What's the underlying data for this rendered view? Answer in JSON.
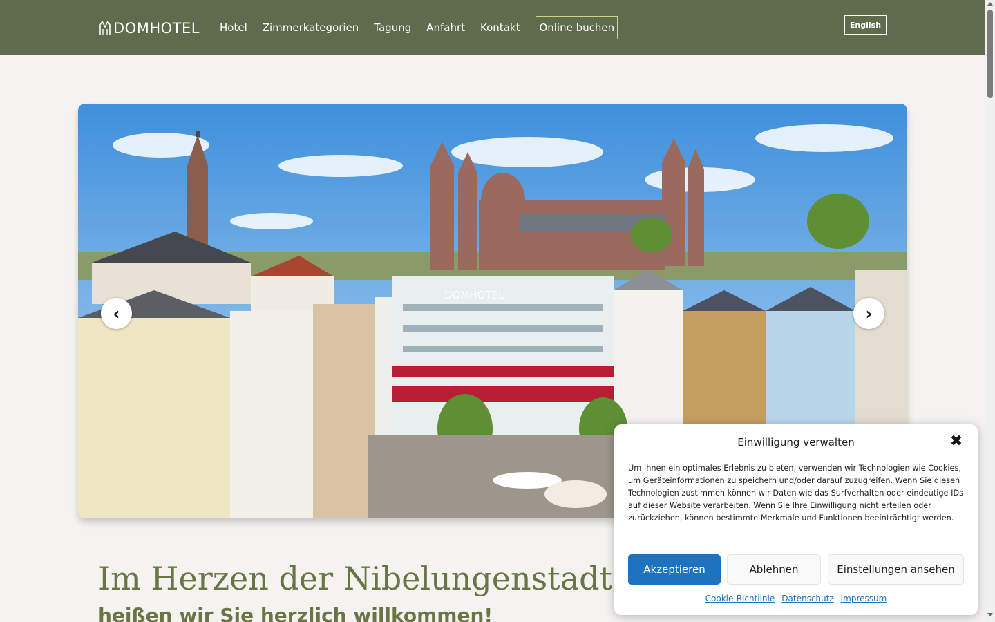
{
  "header": {
    "logo_text": "DOMHOTEL",
    "nav": [
      "Hotel",
      "Zimmerkategorien",
      "Tagung",
      "Anfahrt",
      "Kontakt"
    ],
    "book_label": "Online buchen",
    "language_label": "English",
    "bg_color": "#5f6b4d",
    "book_border_color": "#cfd57a"
  },
  "hero": {
    "image_alt": "Aerial view of Domhotel Worms with the cathedral",
    "sign_text": "DOMHOTEL",
    "prev_icon": "chevron-left-icon",
    "next_icon": "chevron-right-icon"
  },
  "intro": {
    "heading": "Im Herzen der Nibelungenstadt Worms",
    "subheading": "heißen wir Sie herzlich willkommen!",
    "color": "#6b7447"
  },
  "cookie": {
    "title": "Einwilligung verwalten",
    "text": "Um Ihnen ein optimales Erlebnis zu bieten, verwenden wir Technologien wie Cookies, um Geräteinformationen zu speichern und/oder darauf zuzugreifen. Wenn Sie diesen Technologien zustimmen können wir Daten wie das Surfverhalten oder eindeutige IDs auf dieser Website verarbeiten. Wenn Sie Ihre Einwilligung nicht erteilen oder zurückziehen, können bestimmte Merkmale und Funktionen beeinträchtigt werden.",
    "accept_label": "Akzeptieren",
    "deny_label": "Ablehnen",
    "prefs_label": "Einstellungen ansehen",
    "links": [
      "Cookie-Richtlinie",
      "Datenschutz",
      "Impressum"
    ],
    "accent_color": "#1e73be"
  }
}
